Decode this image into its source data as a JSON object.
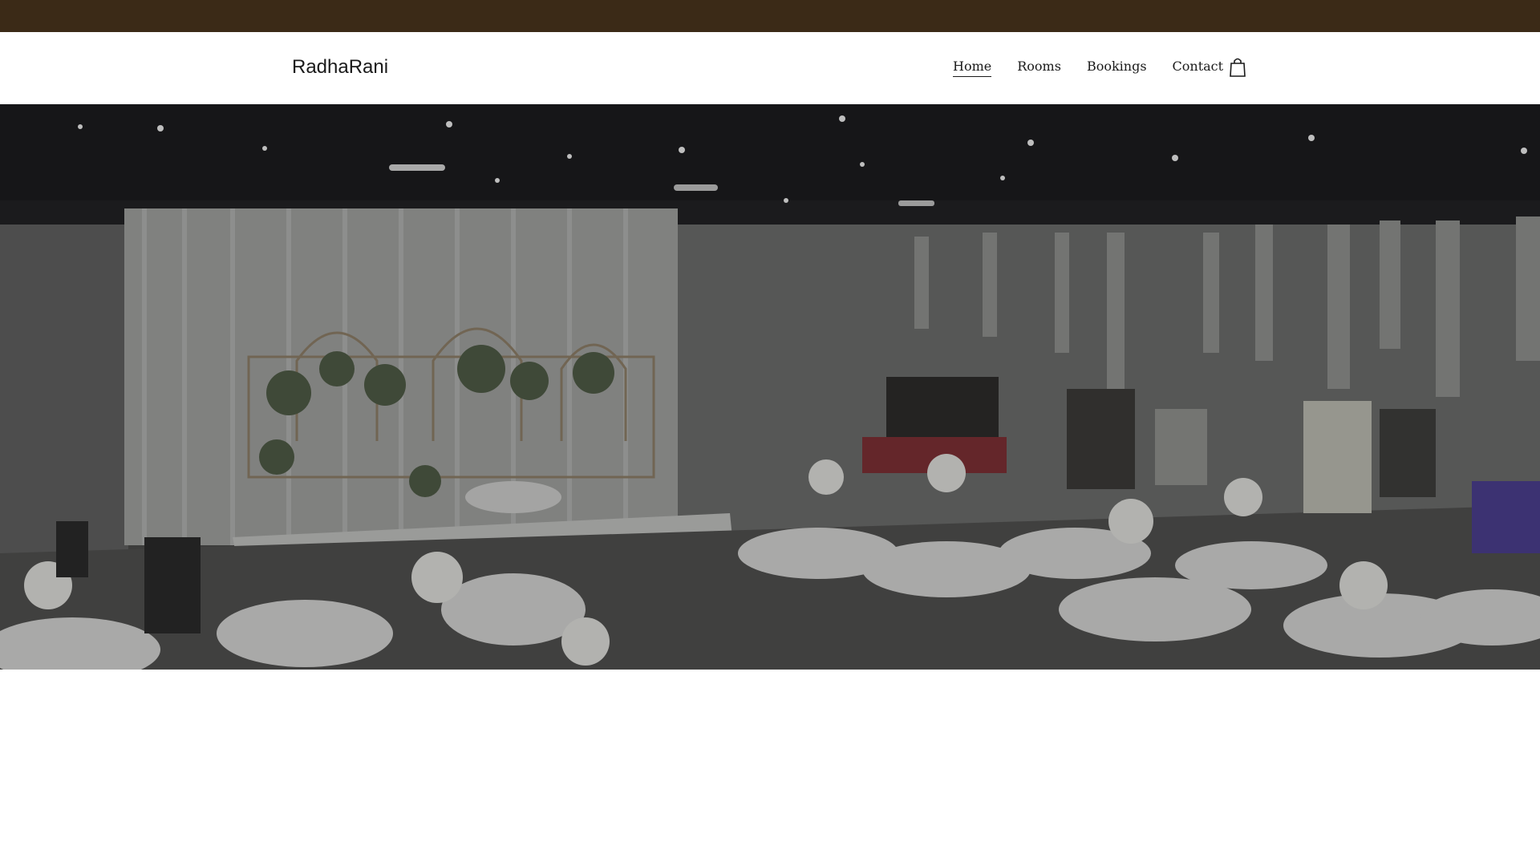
{
  "topbar": {
    "color": "#3b2a17"
  },
  "header": {
    "brand": "RadhaRani",
    "nav": [
      {
        "label": "Home",
        "active": true
      },
      {
        "label": "Rooms",
        "active": false
      },
      {
        "label": "Bookings",
        "active": false
      },
      {
        "label": "Contact",
        "active": false
      }
    ],
    "cart_icon": "shopping-bag-icon"
  },
  "hero": {
    "image": "banquet-hall-photo",
    "overlay": "dark"
  }
}
